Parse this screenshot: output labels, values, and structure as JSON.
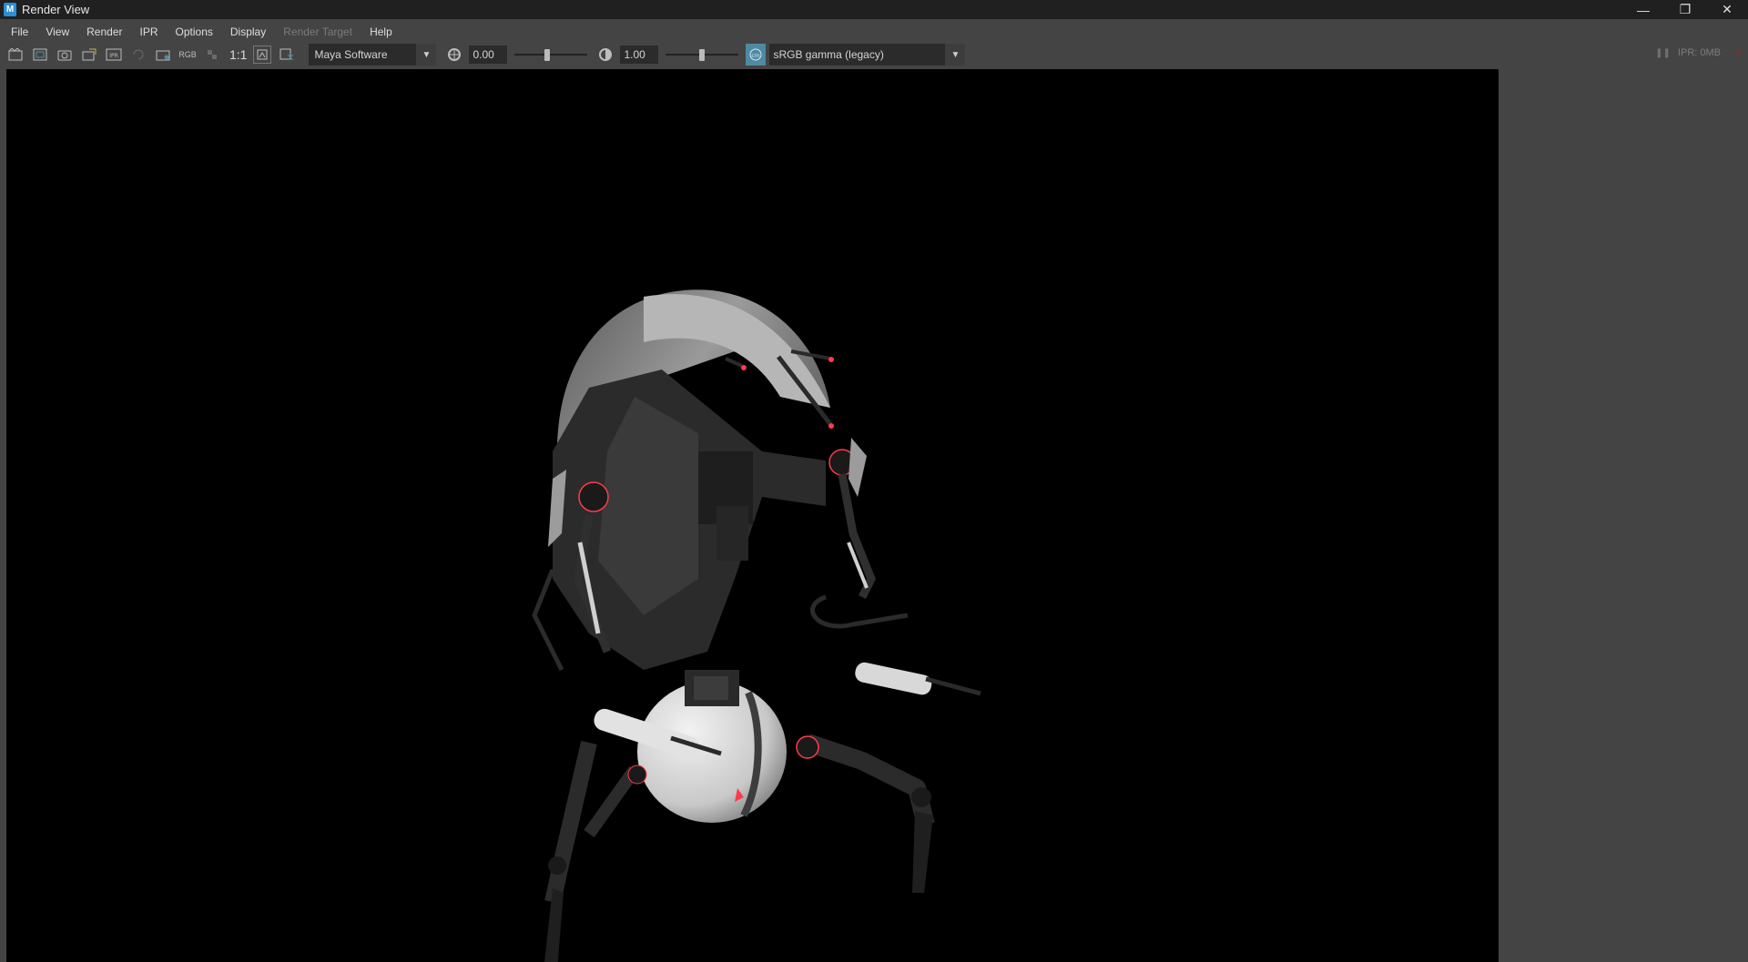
{
  "window": {
    "title": "Render View",
    "app_icon": "M"
  },
  "window_controls": {
    "minimize": "—",
    "restore": "❐",
    "close": "✕"
  },
  "menu": [
    {
      "label": "File",
      "enabled": true
    },
    {
      "label": "View",
      "enabled": true
    },
    {
      "label": "Render",
      "enabled": true
    },
    {
      "label": "IPR",
      "enabled": true
    },
    {
      "label": "Options",
      "enabled": true
    },
    {
      "label": "Display",
      "enabled": true
    },
    {
      "label": "Render Target",
      "enabled": false
    },
    {
      "label": "Help",
      "enabled": true
    }
  ],
  "toolbar": {
    "rgb_label": "RGB",
    "ipr_label": "IPR",
    "ratio_label": "1:1",
    "renderer": "Maya Software",
    "exposure_value": "0.00",
    "exposure_level": 0.45,
    "gamma_value": "1.00",
    "gamma_level": 0.5,
    "color_space": "sRGB gamma (legacy)",
    "color_btn_glyph": "cm"
  },
  "status": {
    "ipr_memory": "IPR: 0MB",
    "pause_glyph": "❚❚",
    "close_glyph": "✕"
  },
  "colors": {
    "window_bg": "#444444",
    "titlebar_bg": "#202020",
    "viewport_bg": "#000000",
    "accent_blue": "#4f8aa3",
    "eye_red": "#ff3b4a"
  }
}
